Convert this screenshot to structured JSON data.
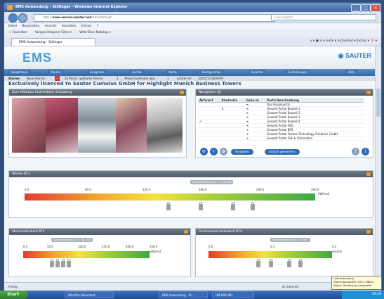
{
  "window": {
    "title": "EMS Anwendung - Stillinger - Windows Internet Explorer",
    "controls": [
      "_",
      "□",
      "✕"
    ]
  },
  "browser": {
    "url_host": "ems-server.sauter.net",
    "url_path": "/ems/default",
    "search_placeholder": "Live Search",
    "menu": [
      "Datei",
      "Bearbeiten",
      "Ansicht",
      "Favoriten",
      "Extras",
      "?"
    ],
    "favorites_label": "Favoriten",
    "fav_items": [
      "Vorgeschlagene Sites ▾",
      "Web Slice-Katalog ▾"
    ],
    "tab_label": "EMS Anwendung - Stillinger",
    "tab_tools": "⌂ ▾  ▣  ✉ ▾  Seite ▾  Sicherheit ▾  Extras ▾  ❓ ▾"
  },
  "app": {
    "logo": "EMS",
    "brand": "SAUTER",
    "nav": [
      "Hauptmenü",
      "Alarme",
      "Ereignisse",
      "Geräte",
      "Werte",
      "Konfiguration",
      "Berichte",
      "Einstellungen"
    ],
    "help": "Hilfe",
    "alarm_bar": {
      "label": "Alarme",
      "new_label": "Neue Alarme",
      "new_count": "1",
      "pending_label": "Zu Punkt: quittierte Alarme",
      "pending_count": "1",
      "user_label": "Meine laufenden Jobs",
      "user_count": "1",
      "last_label": "Letzter Ist:",
      "last_value": "20/01/17/2009/09"
    },
    "page_title": "Exclusively licenced to Sauter Cumulus GmbH for Highlight Munich Business Towers"
  },
  "photos_panel": {
    "title": "Zum Mitinbau Facheinblick Schauberg"
  },
  "navigation_panel": {
    "title": "Navigation (5)",
    "columns": [
      "Aktiviert",
      "Startseite",
      "Gehe zu",
      "Portal Beschreibung"
    ],
    "rows": [
      {
        "start": "",
        "active": "",
        "desc": "Das Hauptportal"
      },
      {
        "start": "⬆",
        "active": "",
        "desc": "Gesamt Portal Bauteil 1"
      },
      {
        "start": "",
        "active": "",
        "desc": "Gesamt Portal Bauteil 2"
      },
      {
        "start": "",
        "active": "",
        "desc": "Gesamt Portal Bauteil 3"
      },
      {
        "start": "",
        "active": "✔",
        "desc": "Gesamt Portal Bauteil 4"
      },
      {
        "start": "",
        "active": "",
        "desc": "Gesamt Portal HD1"
      },
      {
        "start": "",
        "active": "",
        "desc": "Gesamt Portal BPS"
      },
      {
        "start": "",
        "active": "",
        "desc": "Gesamt Portal Fairbox Technology Solutions GmbH"
      },
      {
        "start": "",
        "active": "",
        "desc": "Gesamt Portal Fish & Richardson"
      }
    ],
    "buttons": {
      "a": "Verwalten",
      "b": "Ansicht generieren"
    }
  },
  "wide_gauge": {
    "title": "Wärme BT3",
    "callout": "Gesamtverbrauch = 179,848",
    "ticks": [
      "0.0",
      "60.0",
      "120.0",
      "180.0",
      "240.0",
      "300.0"
    ],
    "unit": "kWh/m2"
  },
  "gauge_left": {
    "title": "Stromverbrauch BT4",
    "callout": "Gesamtverbrauch = 63,049",
    "ticks": [
      "0.0",
      "50.0",
      "100.0",
      "150.0",
      "200.0",
      "250.0"
    ],
    "unit": "kWh/m2"
  },
  "gauge_right": {
    "title": "Frischwasserverbrauch BT4",
    "callout": "Gesamtverbrauch = 0,000",
    "ticks": [
      "0.0",
      "0.1",
      "0.2"
    ],
    "unit": "m3/m2"
  },
  "status": {
    "left": "Fertig",
    "zone": "Internet",
    "zoom": "100%"
  },
  "tooltip": [
    "LAN-Verbindung",
    "Übertragungsrate: 100,0 MBit/s",
    "Status: Verbindung hergestellt"
  ],
  "taskbar": {
    "start": "Start",
    "tasks": [
      "WordPro Dokument",
      "EMS Anwendung - St...",
      "UM EMS 001"
    ],
    "clock": "09:28"
  }
}
